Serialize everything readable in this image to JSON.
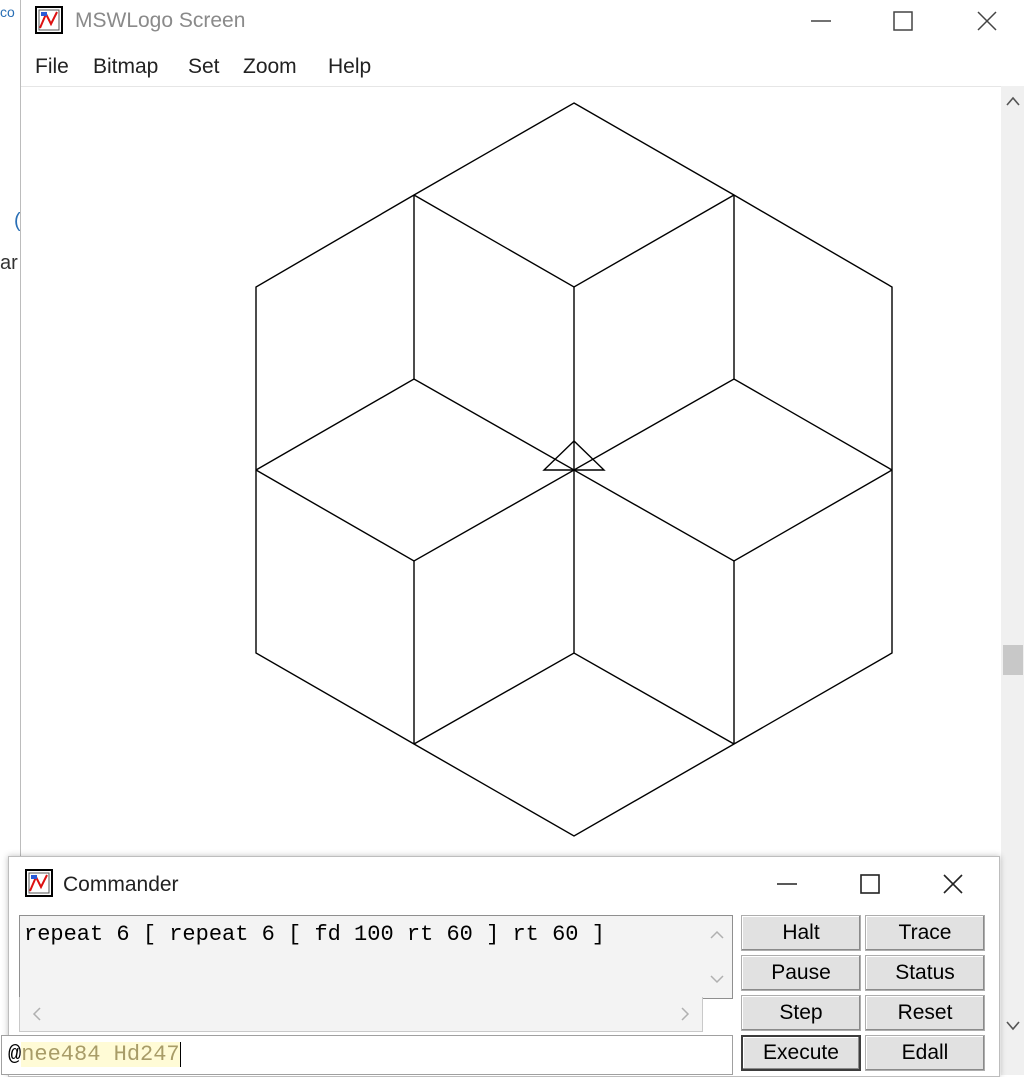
{
  "background_window": {
    "fragments": [
      "co",
      "(",
      "ar"
    ]
  },
  "window": {
    "title": "MSWLogo Screen",
    "controls": {
      "minimize": "minimize-icon",
      "maximize": "maximize-icon",
      "close": "close-icon"
    }
  },
  "menu": {
    "items": [
      {
        "label": "File"
      },
      {
        "label": "Bitmap"
      },
      {
        "label": "Set"
      },
      {
        "label": "Zoom"
      },
      {
        "label": "Help"
      }
    ]
  },
  "canvas": {
    "drawing": "six rhombi forming a hexagonal star of cubes",
    "turtle": "turtle-triangle-icon"
  },
  "commander": {
    "title": "Commander",
    "history": "repeat 6 [ repeat 6 [ fd 100 rt 60 ] rt 60 ]",
    "input_prefix": "@",
    "input_value": "nee484 Hd247",
    "buttons": {
      "halt": "Halt",
      "trace": "Trace",
      "pause": "Pause",
      "status": "Status",
      "step": "Step",
      "reset": "Reset",
      "execute": "Execute",
      "edall": "Edall"
    }
  },
  "colors": {
    "line": "#000000",
    "background": "#ffffff",
    "button_face": "#e1e1e1"
  }
}
